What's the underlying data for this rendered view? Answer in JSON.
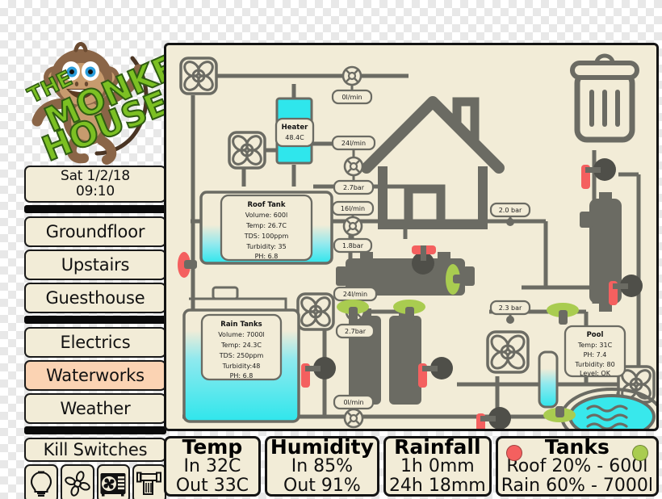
{
  "logo": {
    "text_the": "THE",
    "text_monkey": "MONKEY",
    "text_house": "HOUSE",
    "icon": "monkey-mascot"
  },
  "sidebar": {
    "clock": {
      "date": "Sat 1/2/18",
      "time": "09:10"
    },
    "items": [
      {
        "label": "Groundfloor",
        "active": false
      },
      {
        "label": "Upstairs",
        "active": false
      },
      {
        "label": "Guesthouse",
        "active": false
      },
      {
        "label": "Electrics",
        "active": false
      },
      {
        "label": "Waterworks",
        "active": true
      },
      {
        "label": "Weather",
        "active": false
      }
    ],
    "kill_switches": {
      "label": "Kill Switches",
      "icons": [
        "lightbulb-icon",
        "fan-icon",
        "air-conditioner-icon",
        "water-pump-icon"
      ]
    }
  },
  "status": {
    "temp": {
      "title": "Temp",
      "line1": "In 32C",
      "line2": "Out 33C"
    },
    "humidity": {
      "title": "Humidity",
      "line1": "In 85%",
      "line2": "Out 91%"
    },
    "rainfall": {
      "title": "Rainfall",
      "line1": "1h 0mm",
      "line2": "24h 18mm"
    },
    "tanks": {
      "title": "Tanks",
      "line1": "Roof 20% - 600l",
      "line2": "Rain 60% - 7000l",
      "left_indicator": "red",
      "right_indicator": "green"
    }
  },
  "diagram": {
    "roof_tank": {
      "title": "Roof Tank",
      "lines": [
        "Volume: 600l",
        "Temp: 26.7C",
        "TDS: 100ppm",
        "Turbidity: 35",
        "PH: 6.8"
      ]
    },
    "rain_tanks": {
      "title": "Rain Tanks",
      "lines": [
        "Volume: 7000l",
        "Temp: 24.3C",
        "TDS: 250ppm",
        "Turbidity:48",
        "PH: 6.8"
      ]
    },
    "pool": {
      "title": "Pool",
      "lines": [
        "Temp: 31C",
        "PH: 7.4",
        "Turbidity: 80",
        "Level: OK"
      ]
    },
    "heater": {
      "title": "Heater",
      "value": "48.4C"
    },
    "gauges": {
      "top_flow": "0l/min",
      "heater_flow": "24l/min",
      "heater_pressure": "2.7bar",
      "roof_flow": "16l/min",
      "roof_pressure": "1.8bar",
      "house_pressure": "2.0 bar",
      "rain_flow": "24l/min",
      "rain_pressure": "2.7bar",
      "filter_pressure": "2.3 bar",
      "bottom_flow": "0l/min"
    }
  },
  "colors": {
    "panel_bg": "#f2ecd7",
    "pipe": "#6b6b63",
    "water": "#38e8ec",
    "valve_closed": "#f4605f",
    "valve_open": "#a9cc50",
    "accent_active": "#fbd3b3",
    "outline": "#141414"
  }
}
